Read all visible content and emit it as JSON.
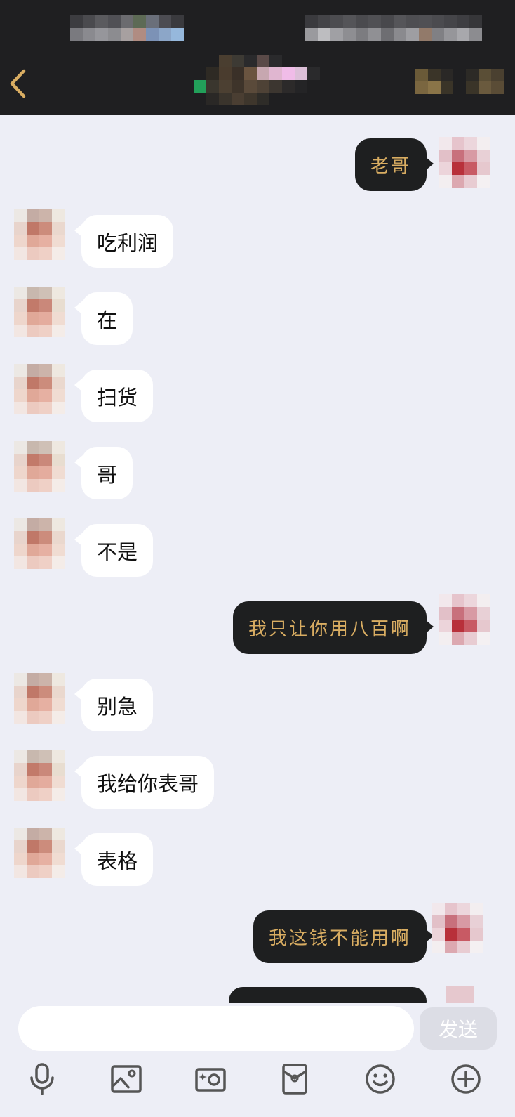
{
  "colors": {
    "header_bg": "#1f1f21",
    "chat_bg": "#edeef6",
    "incoming_bubble": "#ffffff",
    "outgoing_bubble": "#1e1f20",
    "outgoing_text": "#d9ad62",
    "back_arrow": "#d9ad62"
  },
  "header": {
    "back_icon": "chevron-left-icon",
    "title": "",
    "status_text": ""
  },
  "messages": [
    {
      "side": "out",
      "text": "老哥"
    },
    {
      "side": "in",
      "text": "吃利润"
    },
    {
      "side": "in",
      "text": "在"
    },
    {
      "side": "in",
      "text": "扫货"
    },
    {
      "side": "in",
      "text": "哥"
    },
    {
      "side": "in",
      "text": "不是"
    },
    {
      "side": "out",
      "text": "我只让你用八百啊"
    },
    {
      "side": "in",
      "text": "别急"
    },
    {
      "side": "in",
      "text": "我给你表哥"
    },
    {
      "side": "in",
      "text": "表格"
    },
    {
      "side": "out",
      "text": "我这钱不能用啊"
    }
  ],
  "composer": {
    "input_value": "",
    "input_placeholder": "",
    "send_label": "发送"
  },
  "toolbar": [
    {
      "icon": "microphone-icon"
    },
    {
      "icon": "image-icon"
    },
    {
      "icon": "camera-icon"
    },
    {
      "icon": "red-packet-icon"
    },
    {
      "icon": "emoji-icon"
    },
    {
      "icon": "plus-icon"
    }
  ]
}
